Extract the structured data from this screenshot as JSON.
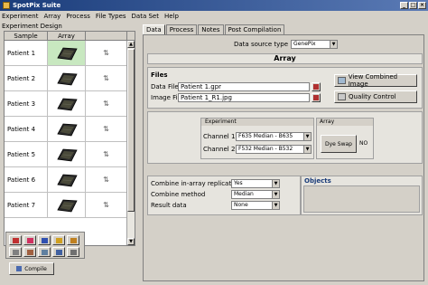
{
  "window": {
    "title": "SpotPix Suite",
    "min": "_",
    "max": "□",
    "close": "×"
  },
  "menu": [
    "Experiment",
    "Array",
    "Process",
    "File Types",
    "Data Set",
    "Help"
  ],
  "left": {
    "section_label": "Experiment Design",
    "columns": [
      "Sample",
      "Array",
      ""
    ],
    "rows": [
      {
        "sample": "Patient 1",
        "icon": "⇅"
      },
      {
        "sample": "Patient 2",
        "icon": "⇅"
      },
      {
        "sample": "Patient 3",
        "icon": "⇅"
      },
      {
        "sample": "Patient 4",
        "icon": "⇅"
      },
      {
        "sample": "Patient 5",
        "icon": "⇅"
      },
      {
        "sample": "Patient 6",
        "icon": "⇅"
      },
      {
        "sample": "Patient 7",
        "icon": "⇅"
      }
    ],
    "compile_label": "Compile"
  },
  "tabs": [
    "Data",
    "Process",
    "Notes",
    "Post Compilation"
  ],
  "data_tab": {
    "data_source_label": "Data source type",
    "data_source_value": "GenePix",
    "array_header": "Array",
    "files_title": "Files",
    "data_file_label": "Data File",
    "data_file_value": "Patient 1.gpr",
    "image_file_label": "Image File",
    "image_file_value": "Patient 1_R1.jpg",
    "view_combined_label": "View Combined Image",
    "quality_control_label": "Quality Control",
    "experiment_header": "Experiment",
    "array_sub_header": "Array",
    "channel1_label": "Channel 1",
    "channel1_value": "F635 Median - B635",
    "channel2_label": "Channel 2",
    "channel2_value": "F532 Median - B532",
    "dye_swap_label": "Dye Swap",
    "dye_swap_value": "NO",
    "combine_replicates_label": "Combine in-array replicates",
    "combine_replicates_value": "Yes",
    "combine_method_label": "Combine method",
    "combine_method_value": "Median",
    "result_data_label": "Result data",
    "result_data_value": "None",
    "objects_title": "Objects"
  },
  "colors": {
    "title_bar": "#1a3c7a",
    "selected_cell": "#c8e8c0"
  }
}
